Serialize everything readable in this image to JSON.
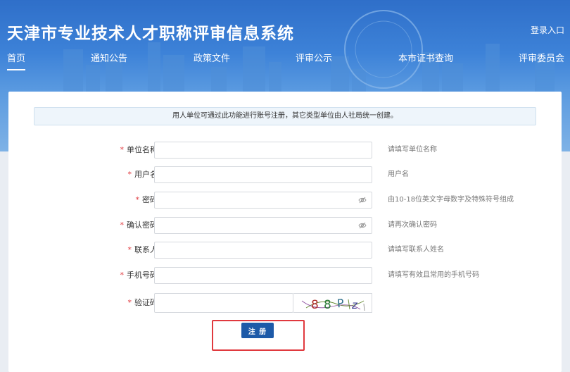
{
  "header": {
    "site_title": "天津市专业技术人才职称评审信息系统",
    "login_label": "登录入口"
  },
  "nav": {
    "items": [
      {
        "label": "首页"
      },
      {
        "label": "通知公告"
      },
      {
        "label": "政策文件"
      },
      {
        "label": "评审公示"
      },
      {
        "label": "本市证书查询"
      },
      {
        "label": "评审委员会"
      }
    ],
    "active_index": 0
  },
  "form": {
    "notice": "用人单位可通过此功能进行账号注册，其它类型单位由人社局统一创建。",
    "required_mark": "*",
    "fields": [
      {
        "label": "单位名称",
        "hint": "请填写单位名称",
        "value": ""
      },
      {
        "label": "用户名",
        "hint": "用户名",
        "value": ""
      },
      {
        "label": "密码",
        "hint": "由10-18位英文字母数字及特殊符号组成",
        "value": ""
      },
      {
        "label": "确认密码",
        "hint": "请再次确认密码",
        "value": ""
      },
      {
        "label": "联系人",
        "hint": "请填写联系人姓名",
        "value": ""
      },
      {
        "label": "手机号码",
        "hint": "请填写有效且常用的手机号码",
        "value": ""
      },
      {
        "label": "验证码",
        "value": ""
      }
    ],
    "captcha_chars": [
      "8",
      "8",
      "P",
      "z"
    ],
    "register_label": "注 册"
  },
  "colors": {
    "primary": "#1d5aa8",
    "required": "#e0393e",
    "highlight": "#e0393e"
  }
}
